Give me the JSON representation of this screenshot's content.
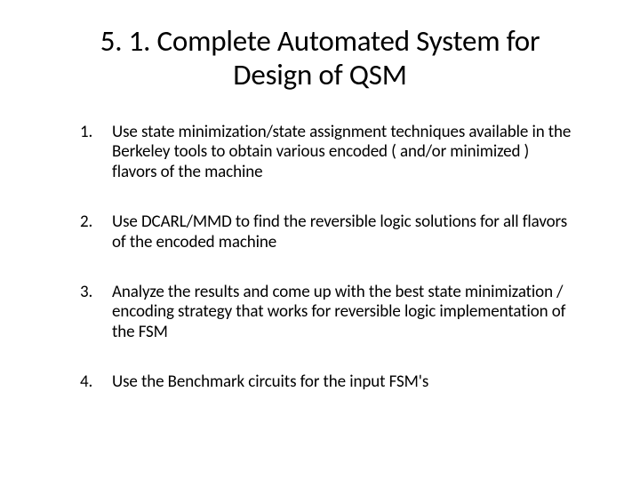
{
  "title": "5. 1. Complete Automated System for Design of QSM",
  "items": [
    "Use state minimization/state assignment  techniques available in the Berkeley tools to obtain various encoded ( and/or minimized ) flavors of the machine",
    "Use DCARL/MMD to find the reversible logic solutions for all flavors of the encoded machine",
    "Analyze the results and come up with the best state minimization / encoding strategy that works for reversible logic implementation of the FSM",
    "Use the Benchmark circuits for the input FSM's"
  ]
}
